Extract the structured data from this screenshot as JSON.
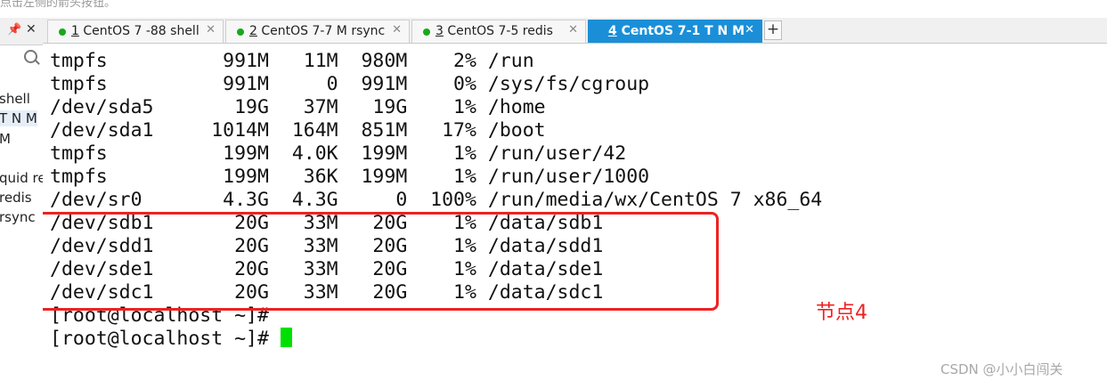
{
  "hint_bar": {
    "text": "点击左侧的箭头按钮。"
  },
  "left_panel": {
    "pin_glyph": "📌",
    "close_glyph": "✕",
    "session_items": [
      "shell",
      "T N M",
      "M",
      "",
      "quid rec",
      "redis",
      "rsync"
    ]
  },
  "tabs": [
    {
      "num": "1",
      "label": " CentOS 7 -88 shell",
      "active": false
    },
    {
      "num": "2",
      "label": " CentOS 7-7 M rsync",
      "active": false
    },
    {
      "num": "3",
      "label": " CentOS 7-5   redis",
      "active": false
    },
    {
      "num": "4",
      "label": " CentOS 7-1 T N M",
      "active": true
    }
  ],
  "tab_close_glyph": "✕",
  "tab_add_glyph": "+",
  "terminal": {
    "lines": [
      "tmpfs          991M   11M  980M    2% /run",
      "tmpfs          991M     0  991M    0% /sys/fs/cgroup",
      "/dev/sda5       19G   37M   19G    1% /home",
      "/dev/sda1     1014M  164M  851M   17% /boot",
      "tmpfs          199M  4.0K  199M    1% /run/user/42",
      "tmpfs          199M   36K  199M    1% /run/user/1000",
      "/dev/sr0       4.3G  4.3G     0  100% /run/media/wx/CentOS 7 x86_64",
      "/dev/sdb1       20G   33M   20G    1% /data/sdb1",
      "/dev/sdd1       20G   33M   20G    1% /data/sdd1",
      "/dev/sde1       20G   33M   20G    1% /data/sde1",
      "/dev/sdc1       20G   33M   20G    1% /data/sdc1",
      "[root@localhost ~]#",
      "[root@localhost ~]# "
    ]
  },
  "annotation": {
    "text": "节点4",
    "color": "#ee2222"
  },
  "watermark": {
    "text": "CSDN @小小白闯关"
  },
  "colors": {
    "accent_tab": "#1a8fd8",
    "cursor": "#00e000",
    "status_dot": "#18a81a"
  }
}
